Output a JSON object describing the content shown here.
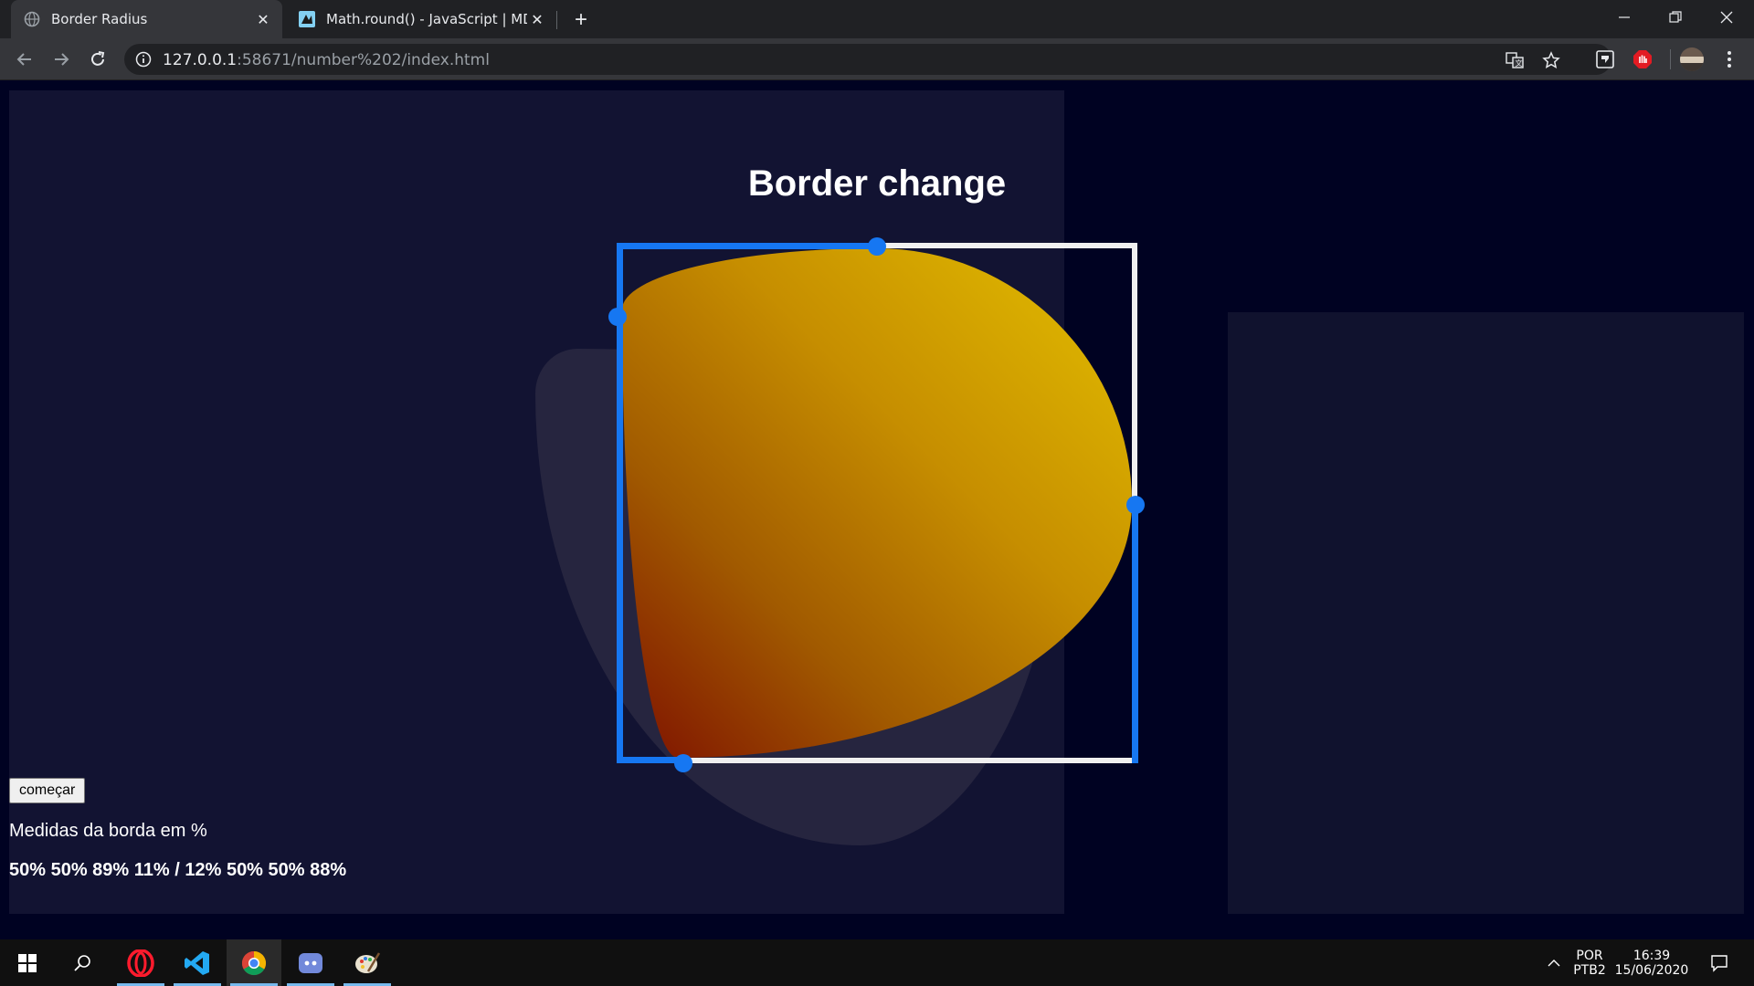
{
  "browser": {
    "tabs": [
      {
        "title": "Border Radius",
        "active": true,
        "close": "✕"
      },
      {
        "title": "Math.round() - JavaScript | MDN",
        "active": false,
        "close": "✕"
      }
    ],
    "new_tab": "+",
    "address": {
      "host": "127.0.0.1",
      "rest": ":58671/number%202/index.html"
    }
  },
  "page": {
    "heading": "Border change",
    "start_button": "começar",
    "measure_label": "Medidas da borda em %",
    "measure_value": "50% 50% 89% 11% / 12% 50% 50% 88%",
    "blob_gradient": [
      "#e4c000",
      "#c68e00",
      "#a15a00",
      "#7e1000"
    ],
    "handle_color": "#1677f2",
    "background_color": "#000222"
  },
  "taskbar": {
    "apps": [
      "windows-start",
      "search",
      "opera",
      "vscode",
      "chrome",
      "discord",
      "paint"
    ],
    "language": "POR",
    "keyboard": "PTB2",
    "time": "16:39",
    "date": "15/06/2020"
  }
}
